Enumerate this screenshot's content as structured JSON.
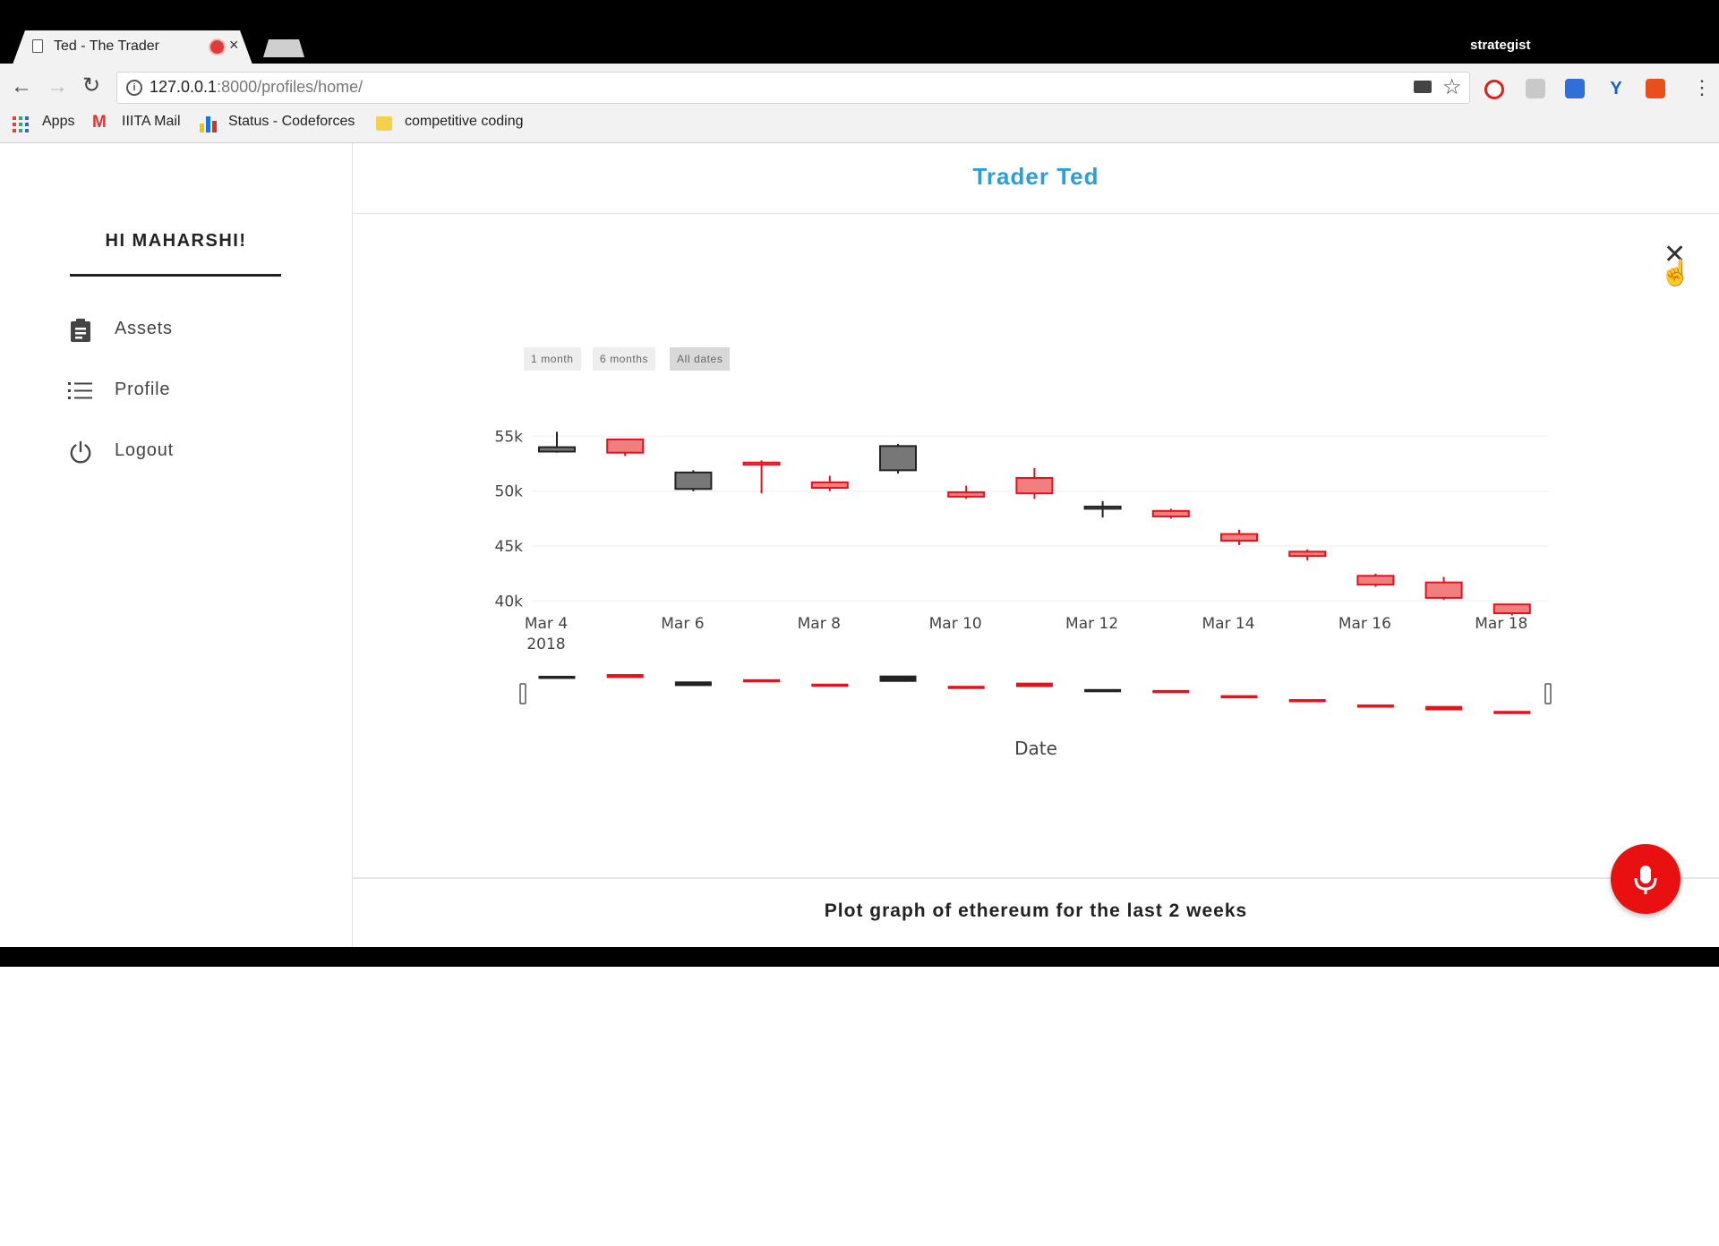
{
  "browser": {
    "tab_title": "Ted - The Trader",
    "tab_close": "×",
    "profile": "strategist",
    "url_host": "127.0.0.1",
    "url_rest": ":8000/profiles/home/",
    "info_glyph": "i",
    "menu_glyph": "⋮",
    "bookmarks": [
      "Apps",
      "IIITA Mail",
      "Status - Codeforces",
      "competitive coding"
    ],
    "icons": [
      "page-icon",
      "record-icon",
      "back-arrow-icon",
      "forward-arrow-icon",
      "reload-icon",
      "info-icon",
      "camera-icon",
      "star-icon",
      "opera-icon",
      "pdf-icon",
      "extension-icon",
      "v-icon",
      "office-icon",
      "menu-icon"
    ]
  },
  "sidebar": {
    "greeting": "HI MAHARSHI!",
    "items": [
      {
        "label": "Assets",
        "icon": "clipboard-icon"
      },
      {
        "label": "Profile",
        "icon": "list-icon"
      },
      {
        "label": "Logout",
        "icon": "power-icon"
      }
    ]
  },
  "header": {
    "title": "Trader Ted"
  },
  "close_glyph": "✕",
  "range_buttons": [
    {
      "label": "1 month",
      "active": false
    },
    {
      "label": "6 months",
      "active": false
    },
    {
      "label": "All dates",
      "active": true
    }
  ],
  "prompt": "Plot graph of ethereum for the last 2 weeks",
  "colors": {
    "accent": "#2a9fd6",
    "increasing": "#222222",
    "increasing_fill": "#777777",
    "decreasing": "#e8101a",
    "decreasing_fill": "#f08080",
    "mic": "#e81010"
  },
  "chart_data": {
    "type": "candlestick",
    "xlabel": "Date",
    "x_ticks": [
      "Mar 4",
      "Mar 6",
      "Mar 8",
      "Mar 10",
      "Mar 12",
      "Mar 14",
      "Mar 16",
      "Mar 18"
    ],
    "x_year": "2018",
    "y_ticks": [
      {
        "v": 40000,
        "label": "40k"
      },
      {
        "v": 45000,
        "label": "45k"
      },
      {
        "v": 50000,
        "label": "50k"
      },
      {
        "v": 55000,
        "label": "55k"
      }
    ],
    "ylim": [
      38500,
      56000
    ],
    "dates": [
      "Mar 4",
      "Mar 5",
      "Mar 6",
      "Mar 7",
      "Mar 8",
      "Mar 9",
      "Mar 10",
      "Mar 11",
      "Mar 12",
      "Mar 13",
      "Mar 14",
      "Mar 15",
      "Mar 16",
      "Mar 17",
      "Mar 18"
    ],
    "ohlc": [
      {
        "o": 53600,
        "h": 55400,
        "l": 53500,
        "c": 54000
      },
      {
        "o": 54700,
        "h": 54700,
        "l": 53200,
        "c": 53500
      },
      {
        "o": 50200,
        "h": 51900,
        "l": 50000,
        "c": 51700
      },
      {
        "o": 52600,
        "h": 52800,
        "l": 49800,
        "c": 52400
      },
      {
        "o": 50800,
        "h": 51400,
        "l": 50000,
        "c": 50300
      },
      {
        "o": 51900,
        "h": 54300,
        "l": 51600,
        "c": 54100
      },
      {
        "o": 49900,
        "h": 50500,
        "l": 49300,
        "c": 49500
      },
      {
        "o": 51200,
        "h": 52100,
        "l": 49300,
        "c": 49800
      },
      {
        "o": 48400,
        "h": 49100,
        "l": 47600,
        "c": 48600
      },
      {
        "o": 48200,
        "h": 48400,
        "l": 47500,
        "c": 47700
      },
      {
        "o": 46100,
        "h": 46500,
        "l": 45100,
        "c": 45500
      },
      {
        "o": 44500,
        "h": 44700,
        "l": 43700,
        "c": 44100
      },
      {
        "o": 42300,
        "h": 42500,
        "l": 41300,
        "c": 41500
      },
      {
        "o": 41700,
        "h": 42200,
        "l": 40100,
        "c": 40300
      },
      {
        "o": 39700,
        "h": 39700,
        "l": 38700,
        "c": 38900
      }
    ],
    "rangeslider": true,
    "grid": true
  }
}
